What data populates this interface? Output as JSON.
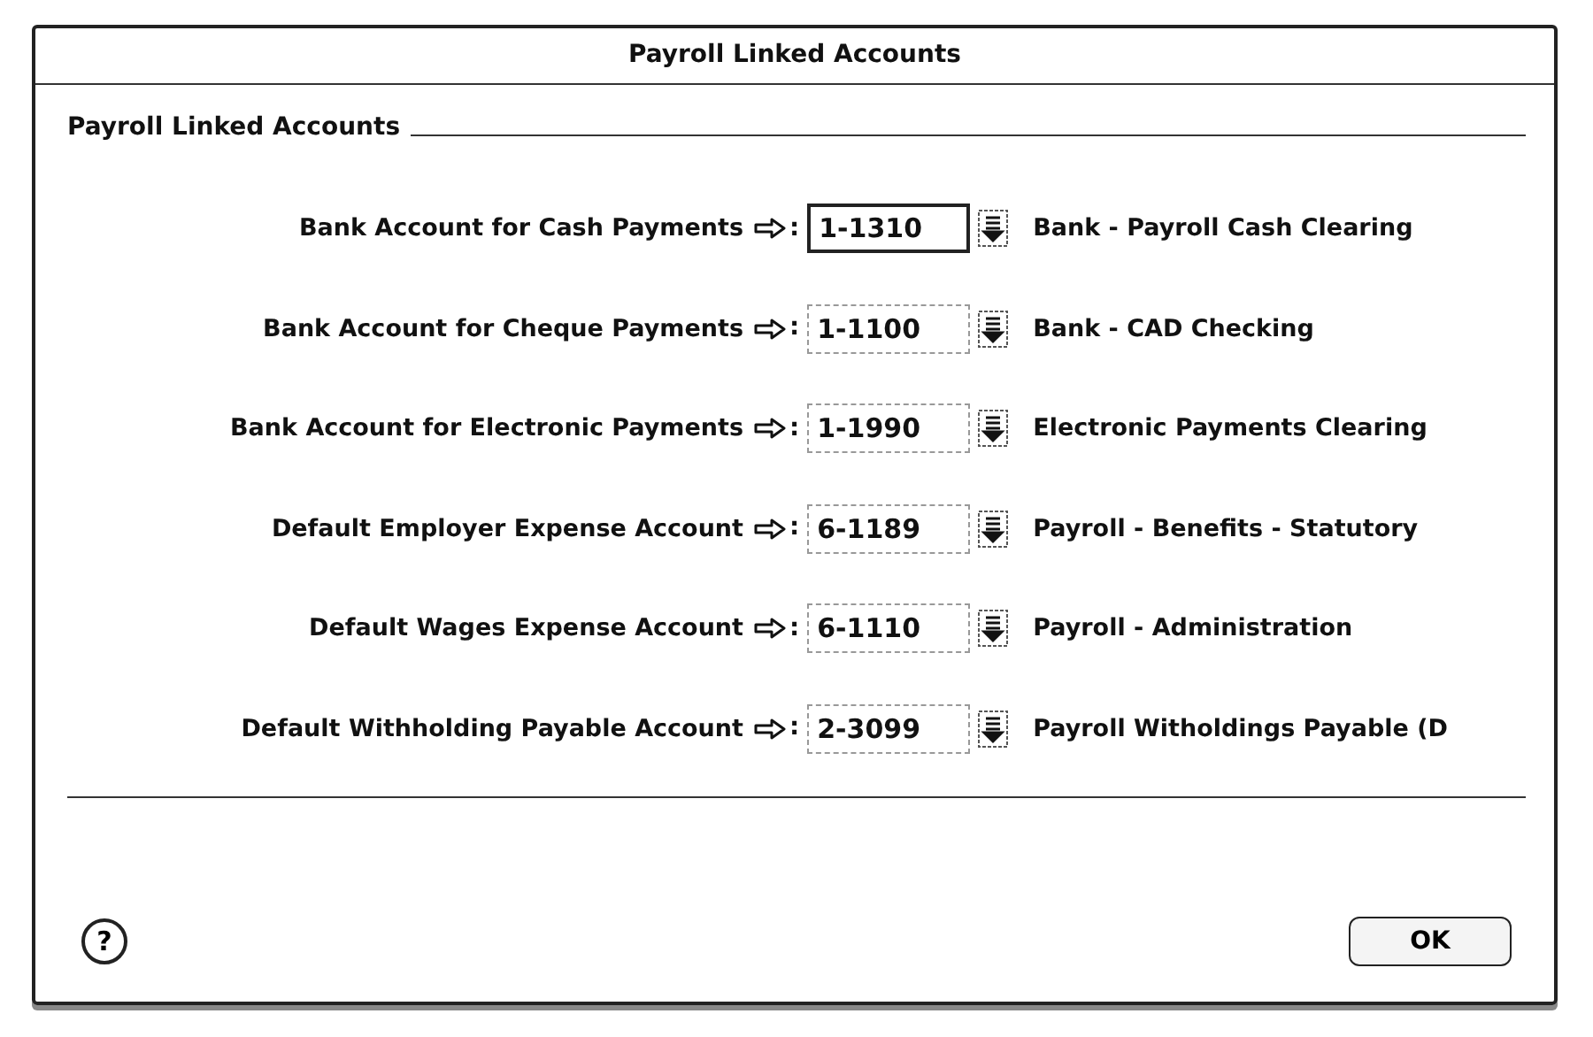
{
  "window": {
    "title": "Payroll Linked Accounts"
  },
  "section": {
    "title": "Payroll Linked Accounts"
  },
  "rows": [
    {
      "label": "Bank Account for Cash Payments",
      "separator": ":",
      "account": "1-1310",
      "focused": true,
      "name": "Bank - Payroll Cash Clearing"
    },
    {
      "label": "Bank Account for Cheque Payments",
      "separator": ":",
      "account": "1-1100",
      "focused": false,
      "name": "Bank - CAD Checking"
    },
    {
      "label": "Bank Account for Electronic Payments",
      "separator": ":",
      "account": "1-1990",
      "focused": false,
      "name": "Electronic Payments Clearing"
    },
    {
      "label": "Default Employer Expense Account",
      "separator": ":",
      "account": "6-1189",
      "focused": false,
      "name": "Payroll - Benefits - Statutory"
    },
    {
      "label": "Default Wages Expense Account",
      "separator": ":",
      "account": "6-1110",
      "focused": false,
      "name": "Payroll - Administration"
    },
    {
      "label": "Default Withholding Payable Account",
      "separator": ":",
      "account": "2-3099",
      "focused": false,
      "name": "Payroll Witholdings Payable (D"
    }
  ],
  "buttons": {
    "help": "?",
    "ok": "OK"
  }
}
